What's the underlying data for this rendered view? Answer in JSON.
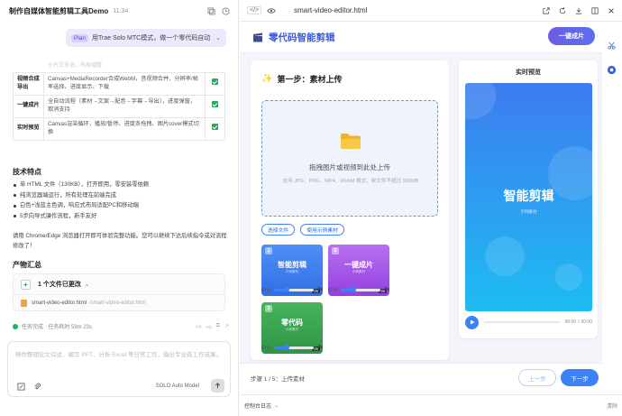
{
  "chat": {
    "title": "制作自媒体智能剪辑工具Demo",
    "time": "11:34",
    "plan_tag": "Plan",
    "plan_text": "用Trae Solo MTC模式，做一个零代码自动",
    "faded_line": "卡片式多选，布局调整",
    "features": [
      {
        "name": "视频合成导出",
        "desc": "Canvas+MediaRecorder合成WebM，音视频合并、分辨率/帧率选择、进度显示、下载"
      },
      {
        "name": "一键成片",
        "desc": "全自动流程（素材→文案→配音→字幕→导出），进度弹窗，取消支持"
      },
      {
        "name": "实时预览",
        "desc": "Canvas渲染循环，播放/暂停、进度条拖拽、图片cover模式切换"
      }
    ],
    "tech_heading": "技术特点",
    "tech_points": [
      "单 HTML 文件（130KB），打开即用，零安装零依赖",
      "纯浏览器端运行，所有处理在前端完成",
      "白色+浅蓝主色调，响应式布局适配PC和移动端",
      "5步向导式操作流程，新手友好"
    ],
    "browser_note": "请用 Chrome/Edge 浏览器打开即可体验完整功能。您可以继续下达后续指令或对流程修改了！",
    "product_heading": "产物汇总",
    "changes_label": "1 个文件已更改",
    "file_name": "smart-video-editor.html",
    "file_path": "/smart-video-editor.html",
    "status_text": "任务完成 · 任务耗时 59m 23s",
    "input_placeholder": "帮你整理论文综述、编写 PPT、分析 Excel 等日常工作，输出专业级工作成果。",
    "model_label": "SOLO Auto Model"
  },
  "editor": {
    "code_icon": "</>",
    "file_name": "smart-video-editor.html"
  },
  "app": {
    "title": "零代码智能剪辑",
    "generate_button": "一键成片",
    "step_title": "第一步：素材上传",
    "drop_title": "拖拽图片或视频到此处上传",
    "drop_sub": "支持 JPG、PNG、MP4、WebM 格式，单文件不超过 500MB",
    "select_button": "选择文件",
    "sample_button": "使用示例素材",
    "duration_label": "时长:",
    "tiles": [
      {
        "num": "1",
        "title": "智能剪辑",
        "sub": "示例素材",
        "duration": "3s",
        "value": "3s",
        "fraction": 0.3,
        "color": "#3b82f6"
      },
      {
        "num": "2",
        "title": "一键成片",
        "sub": "示例素材",
        "duration": "3s",
        "value": "3s",
        "fraction": 0.3,
        "color": "#a855f7"
      },
      {
        "num": "3",
        "title": "零代码",
        "sub": "示例素材",
        "duration": "3s",
        "value": "3s",
        "fraction": 0.3,
        "color": "#22a043"
      }
    ],
    "preview_heading": "实时预览",
    "preview_title": "智能剪辑",
    "preview_sub": "示例素材",
    "time_current": "00:00",
    "time_total": "00:00",
    "step_status": "步骤 1 / 5：上传素材",
    "prev_button": "上一步",
    "next_button": "下一步"
  },
  "console": {
    "label": "控制台日志",
    "clear": "清除"
  },
  "colors": {
    "accent": "#3b82f6",
    "title_blue": "#3b5bdb",
    "success": "#16b35a"
  }
}
